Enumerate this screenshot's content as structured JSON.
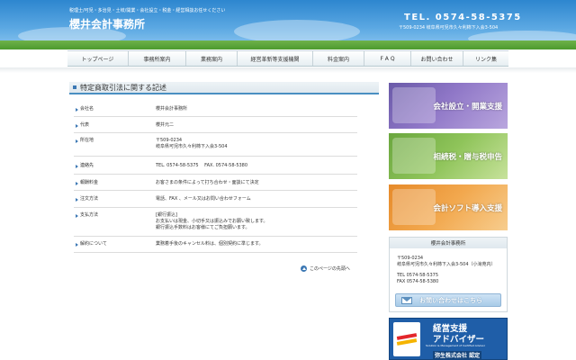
{
  "header": {
    "tagline": "税理士/可児・多治見・土岐/開業・会社設立・税金・経営相談お任せください",
    "site_title": "櫻井会計事務所",
    "phone": "TEL. 0574-58-5375",
    "address": "〒509-0234 岐阜県可児市久々利柿下入会3-504"
  },
  "nav": {
    "items": [
      "トップページ",
      "事務所案内",
      "業務案内",
      "経営革新等支援機関",
      "料金案内",
      "F A Q",
      "お問い合わせ",
      "リンク集"
    ]
  },
  "main": {
    "heading": "特定商取引法に関する記述",
    "rows": [
      {
        "label": "会社名",
        "lines": [
          "櫻井会計事務所"
        ]
      },
      {
        "label": "代表",
        "lines": [
          "櫻井元二"
        ]
      },
      {
        "label": "所在地",
        "lines": [
          "〒509-0234",
          "岐阜県可児市久々利柿下入会3-504"
        ]
      },
      {
        "label": "連絡先",
        "lines": [
          "TEL. 0574-58-5375　 FAX. 0574-58-5380"
        ]
      },
      {
        "label": "報酬料金",
        "lines": [
          "お客さまの条件によって打ち合わせ・面談にて決定"
        ]
      },
      {
        "label": "注文方法",
        "lines": [
          "電話、FAX 、メール又はお問い合わせフォーム"
        ]
      },
      {
        "label": "支払方法",
        "lines": [
          "[銀行振込]",
          "お支払いは現金、小切手又は振込みでお願い致します。",
          "銀行振込手数料はお客様にてご負担願います。"
        ]
      },
      {
        "label": "解約について",
        "lines": [
          "業務着手後のキャンセル料は、個別契約に準じます。"
        ]
      }
    ],
    "to_top": "このページの先頭へ"
  },
  "sidebar": {
    "banners": [
      "会社設立・開業支援",
      "相続税・贈与税申告",
      "会計ソフト導入支援"
    ],
    "office_name": "櫻井会計事務所",
    "postal": "〒509-0234",
    "address": "岐阜県可児市久々利柿下入会3-504（小滝苑内）",
    "tel": "TEL 0574-58-5375",
    "fax": "FAX 0574-58-5380",
    "contact_button": "お問い合わせはこちら",
    "badge": {
      "line1": "経営支援",
      "line2": "アドバイザー",
      "small": "Solution & Management of Certified Advisor",
      "certified": "弥生株式会社 認定"
    }
  },
  "colors": {
    "sky": "#2d86cf",
    "grass": "#4c9a2e",
    "accent": "#3c78b4",
    "badge_blue": "#1f5ea8"
  }
}
